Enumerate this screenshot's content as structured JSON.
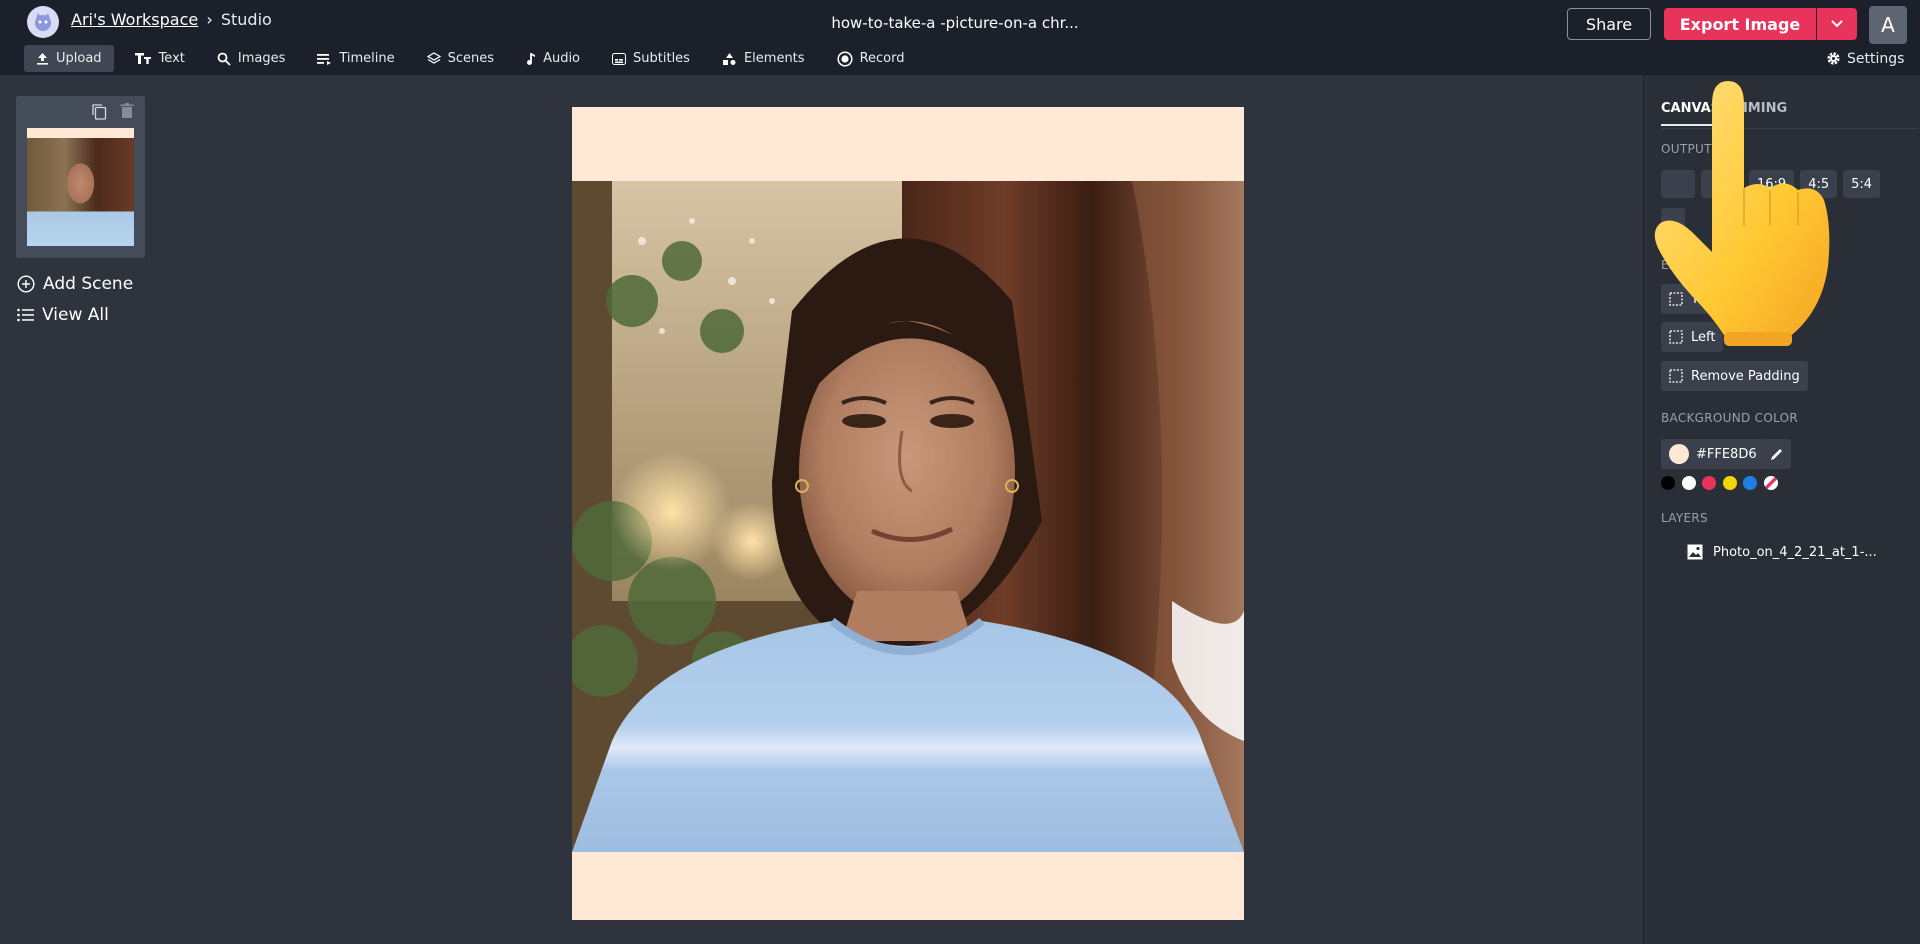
{
  "header": {
    "workspace": "Ari's Workspace",
    "separator": "›",
    "section": "Studio",
    "project_title": "how-to-take-a -picture-on-a chr...",
    "share_label": "Share",
    "export_label": "Export Image",
    "avatar_letter": "A"
  },
  "toolbar": {
    "items": [
      {
        "label": "Upload",
        "icon": "upload-icon"
      },
      {
        "label": "Text",
        "icon": "text-icon"
      },
      {
        "label": "Images",
        "icon": "search-icon"
      },
      {
        "label": "Timeline",
        "icon": "timeline-icon"
      },
      {
        "label": "Scenes",
        "icon": "layers-icon"
      },
      {
        "label": "Audio",
        "icon": "music-note-icon"
      },
      {
        "label": "Subtitles",
        "icon": "subtitles-icon"
      },
      {
        "label": "Elements",
        "icon": "shapes-icon"
      },
      {
        "label": "Record",
        "icon": "record-icon"
      }
    ],
    "settings_label": "Settings"
  },
  "scenes": {
    "add_scene_label": "Add Scene",
    "view_all_label": "View All"
  },
  "right_panel": {
    "tabs": [
      "CANVAS",
      "TIMING"
    ],
    "output_size_label": "OUTPUT SIZE",
    "ratios": [
      "16:9",
      "4:5",
      "5:4"
    ],
    "expand_label": "EXPAND",
    "padding_options": [
      "Top",
      "Left",
      "Remove Padding"
    ],
    "background_color_label": "BACKGROUND COLOR",
    "background_color_value": "#FFE8D6",
    "swatches": [
      "#000000",
      "#ffffff",
      "#e8335a",
      "#f2d600",
      "#1e7fe0",
      "none"
    ],
    "layers_label": "LAYERS",
    "layers": [
      {
        "name": "Photo_on_4_2_21_at_1-...",
        "icon": "image-icon"
      }
    ]
  },
  "canvas": {
    "background": "#FFE8D6"
  }
}
